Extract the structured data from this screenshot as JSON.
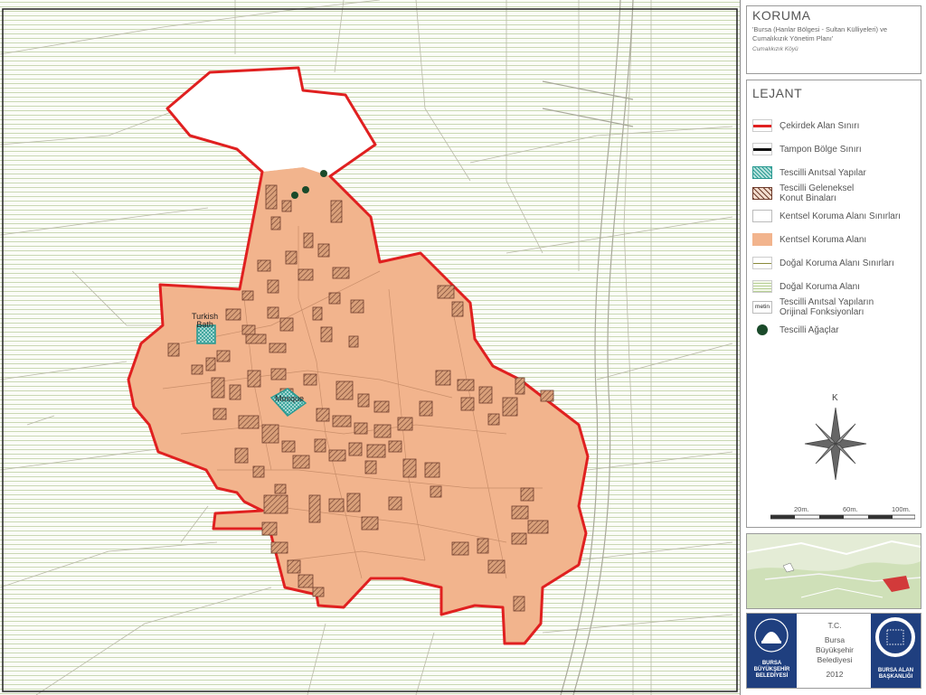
{
  "map": {
    "labels": {
      "turkish_bath": "Turkish\nBath",
      "mosque": "Mosque"
    },
    "colors": {
      "conservation_area": "#f2b48d",
      "core_boundary": "#e02020",
      "natural_area_lines": "#c8d8b4",
      "registered_building": "#7a4a3a",
      "monument": "#3aa8a0",
      "trees": "#1a4a2a"
    }
  },
  "panel": {
    "title": "KORUMA",
    "subtitle": "'Bursa (Hanlar Bölgesi - Sultan Külliyeleri) ve\nCumalıkızık Yönetim Planı'",
    "village": "Cumalıkızık Köyü",
    "legend_title": "LEJANT",
    "legend": [
      {
        "label": "Çekirdek Alan Sınırı",
        "icon": "red-line-icon"
      },
      {
        "label": "Tampon Bölge Sınırı",
        "icon": "black-line-icon"
      },
      {
        "label": "Tescilli Anıtsal Yapılar",
        "icon": "teal-hatch-icon"
      },
      {
        "label": "Tescilli Geleneksel\nKonut Binaları",
        "icon": "brown-hatch-icon"
      },
      {
        "label": "Kentsel Koruma Alanı Sınırları",
        "icon": "white-box-icon"
      },
      {
        "label": "Kentsel Koruma Alanı",
        "icon": "orange-box-icon"
      },
      {
        "label": "Doğal Koruma Alanı Sınırları",
        "icon": "olive-line-icon"
      },
      {
        "label": "Doğal Koruma Alanı",
        "icon": "green-lines-icon"
      },
      {
        "label": "Tescilli Anıtsal Yapıların\nOrijinal Fonksiyonları",
        "icon": "metin-box-icon",
        "swatch_text": "metin"
      },
      {
        "label": "Tescilli Ağaçlar",
        "icon": "tree-dot-icon"
      }
    ],
    "north_label": "K",
    "scale_labels": [
      "20m.",
      "60m.",
      "100m."
    ],
    "footer": {
      "left_logo_text": "BURSA\nBÜYÜKŞEHİR\nBELEDİYESİ",
      "center_lines": [
        "T.C.",
        "Bursa",
        "Büyükşehir",
        "Belediyesi",
        "2012"
      ],
      "right_logo_text": "BURSA ALAN\nBAŞKANLIĞI"
    }
  }
}
